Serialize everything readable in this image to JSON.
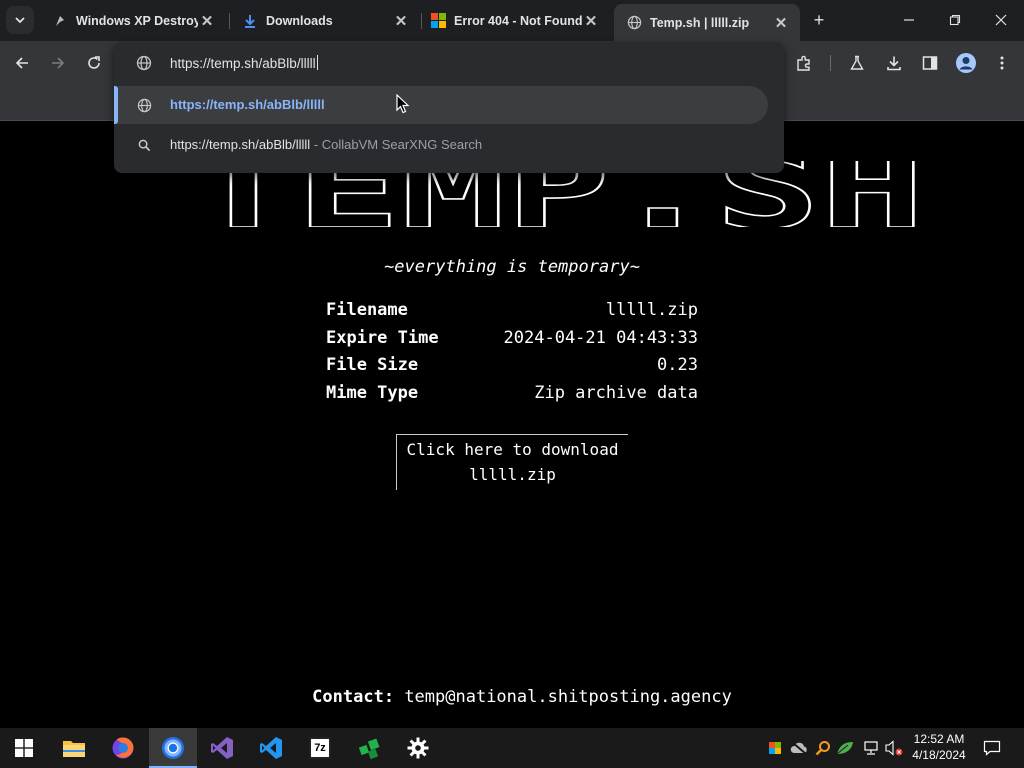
{
  "browser": {
    "tabs": [
      {
        "title": "Windows XP Destroye",
        "favicon": "xp-icon",
        "active": false
      },
      {
        "title": "Downloads",
        "favicon": "download-icon",
        "active": false
      },
      {
        "title": "Error 404 - Not Found",
        "favicon": "windows-logo-icon",
        "active": false
      },
      {
        "title": "Temp.sh | lllll.zip",
        "favicon": "globe-icon",
        "active": true
      }
    ],
    "close_glyph": "✕",
    "new_tab_glyph": "+"
  },
  "omnibox": {
    "input_value": "https://temp.sh/abBlb/lllll",
    "suggestions": [
      {
        "text": "https://temp.sh/abBlb/lllll",
        "sub": "",
        "icon": "globe-icon",
        "selected": true
      },
      {
        "text": "https://temp.sh/abBlb/lllll",
        "sub": " - CollabVM SearXNG Search",
        "icon": "search-icon",
        "selected": false
      }
    ]
  },
  "page": {
    "logo_text": "TEMP.SH",
    "tagline": "~everything is temporary~",
    "info": [
      {
        "key": "Filename",
        "value": "lllll.zip"
      },
      {
        "key": "Expire Time",
        "value": "2024-04-21 04:43:33"
      },
      {
        "key": "File Size",
        "value": "0.23"
      },
      {
        "key": "Mime Type",
        "value": "Zip archive data"
      }
    ],
    "download_line1": "Click here to download",
    "download_line2": "lllll.zip",
    "contact_label": "Contact:",
    "contact_email": "temp@national.shitposting.agency"
  },
  "taskbar": {
    "apps": [
      "start-icon",
      "file-explorer-icon",
      "firefox-icon",
      "chrome-icon",
      "visual-studio-icon",
      "vscode-icon",
      "7zip-icon",
      "green-app-icon",
      "settings-icon"
    ],
    "active_app": "chrome-icon",
    "seven_zip_label": "7z",
    "clock_time": "12:52 AM",
    "clock_date": "4/18/2024"
  },
  "colors": {
    "accent_link": "#8ab4f8",
    "tab_bar": "#1e1f22",
    "toolbar": "#35363a"
  }
}
